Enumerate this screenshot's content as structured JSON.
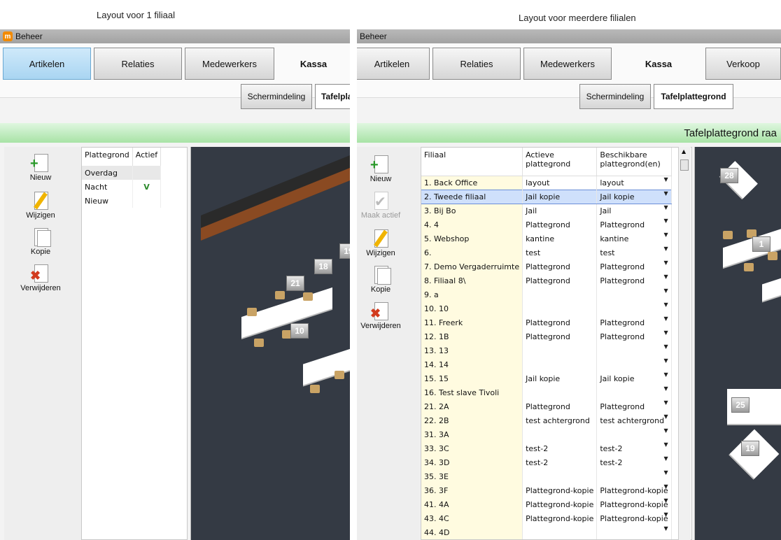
{
  "captions": {
    "left": "Layout voor 1 filiaal",
    "right": "Layout voor meerdere filialen"
  },
  "window": {
    "title": "Beheer"
  },
  "nav": {
    "artikelen": "Artikelen",
    "relaties": "Relaties",
    "medewerkers": "Medewerkers",
    "kassa": "Kassa",
    "verkoop": "Verkoop"
  },
  "subnav": {
    "schermindeling": "Schermindeling",
    "tafelplattegrond_left": "Tafelpla",
    "tafelplattegrond": "Tafelplattegrond"
  },
  "header_bar": {
    "right": "Tafelplattegrond raa"
  },
  "toolbar": {
    "nieuw": "Nieuw",
    "maak_actief": "Maak actief",
    "wijzigen": "Wijzigen",
    "kopie": "Kopie",
    "verwijderen": "Verwijderen"
  },
  "left_table": {
    "headers": [
      "Plattegrond",
      "Actief"
    ],
    "rows": [
      {
        "name": "Overdag",
        "actief": ""
      },
      {
        "name": "Nacht",
        "actief": "V"
      },
      {
        "name": "Nieuw",
        "actief": ""
      }
    ]
  },
  "right_table": {
    "headers": [
      "Filiaal",
      "Actieve plattegrond",
      "Beschikbare plattegrond(en)"
    ],
    "rows": [
      {
        "filiaal": "1. Back Office",
        "actief": "layout",
        "beschikbaar": "layout"
      },
      {
        "filiaal": "2. Tweede filiaal",
        "actief": "Jail kopie",
        "beschikbaar": "Jail kopie"
      },
      {
        "filiaal": "3. Bij Bo",
        "actief": "Jail",
        "beschikbaar": "Jail"
      },
      {
        "filiaal": "4. 4",
        "actief": "Plattegrond",
        "beschikbaar": "Plattegrond"
      },
      {
        "filiaal": "5. Webshop",
        "actief": "kantine",
        "beschikbaar": "kantine"
      },
      {
        "filiaal": "6.",
        "actief": "test",
        "beschikbaar": "test"
      },
      {
        "filiaal": "7. Demo Vergaderruimte",
        "actief": "Plattegrond",
        "beschikbaar": "Plattegrond"
      },
      {
        "filiaal": "8. Filiaal 8\\",
        "actief": "Plattegrond",
        "beschikbaar": "Plattegrond"
      },
      {
        "filiaal": "9. a",
        "actief": "",
        "beschikbaar": ""
      },
      {
        "filiaal": "10. 10",
        "actief": "",
        "beschikbaar": ""
      },
      {
        "filiaal": "11. Freerk",
        "actief": "Plattegrond",
        "beschikbaar": "Plattegrond"
      },
      {
        "filiaal": "12. 1B",
        "actief": "Plattegrond",
        "beschikbaar": "Plattegrond"
      },
      {
        "filiaal": "13. 13",
        "actief": "",
        "beschikbaar": ""
      },
      {
        "filiaal": "14. 14",
        "actief": "",
        "beschikbaar": ""
      },
      {
        "filiaal": "15. 15",
        "actief": "Jail kopie",
        "beschikbaar": "Jail kopie"
      },
      {
        "filiaal": "16. Test slave Tivoli",
        "actief": "",
        "beschikbaar": ""
      },
      {
        "filiaal": "21. 2A",
        "actief": "Plattegrond",
        "beschikbaar": "Plattegrond"
      },
      {
        "filiaal": "22. 2B",
        "actief": "test achtergrond",
        "beschikbaar": "test achtergrond"
      },
      {
        "filiaal": "31. 3A",
        "actief": "",
        "beschikbaar": ""
      },
      {
        "filiaal": "33. 3C",
        "actief": "test-2",
        "beschikbaar": "test-2"
      },
      {
        "filiaal": "34. 3D",
        "actief": "test-2",
        "beschikbaar": "test-2"
      },
      {
        "filiaal": "35. 3E",
        "actief": "",
        "beschikbaar": ""
      },
      {
        "filiaal": "36. 3F",
        "actief": "Plattegrond-kopie",
        "beschikbaar": "Plattegrond-kopie"
      },
      {
        "filiaal": "41. 4A",
        "actief": "Plattegrond-kopie",
        "beschikbaar": "Plattegrond-kopie"
      },
      {
        "filiaal": "43. 4C",
        "actief": "Plattegrond-kopie",
        "beschikbaar": "Plattegrond-kopie"
      },
      {
        "filiaal": "44. 4D",
        "actief": "",
        "beschikbaar": ""
      }
    ]
  },
  "floorplan_left": {
    "table_numbers": [
      "10",
      "18",
      "21",
      "19"
    ]
  },
  "floorplan_right": {
    "table_numbers": [
      "28",
      "1",
      "25",
      "19"
    ]
  },
  "colors": {
    "accent_selected": "#cfe0fb",
    "filiaal_column": "#fffbe0",
    "green_bar": "#a8e3a6",
    "floor_bg": "#343a44",
    "active_tab": "#a9d5f2"
  }
}
